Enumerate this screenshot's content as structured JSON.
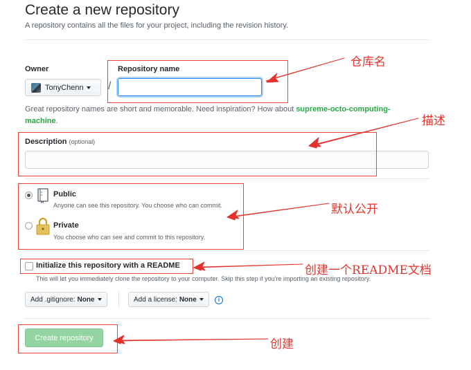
{
  "header": {
    "title": "Create a new repository",
    "subtitle": "A repository contains all the files for your project, including the revision history."
  },
  "owner": {
    "label": "Owner",
    "value": "TonyChenn"
  },
  "repo": {
    "label": "Repository name",
    "value": ""
  },
  "hint": {
    "prefix": "Great repository names are short and memorable. Need inspiration? How about ",
    "suggestion": "supreme-octo-computing-machine",
    "suffix": "."
  },
  "description": {
    "label": "Description",
    "optional": "(optional)",
    "value": ""
  },
  "visibility": {
    "public": {
      "title": "Public",
      "desc": "Anyone can see this repository. You choose who can commit.",
      "checked": true
    },
    "private": {
      "title": "Private",
      "desc": "You choose who can see and commit to this repository.",
      "checked": false
    }
  },
  "readme": {
    "label": "Initialize this repository with a README",
    "desc": "This will let you immediately clone the repository to your computer. Skip this step if you're importing an existing repository."
  },
  "gitignore": {
    "label": "Add .gitignore:",
    "value": "None"
  },
  "license": {
    "label": "Add a license:",
    "value": "None"
  },
  "create_button": "Create repository",
  "annotations": {
    "repo_name": "仓库名",
    "description": "描述",
    "visibility": "默认公开",
    "readme": "创建一个README文档",
    "create": "创建"
  },
  "colors": {
    "annotation": "#e3322b",
    "create_button": "#94d3a2",
    "suggestion": "#28a745",
    "focus": "#2188ff"
  }
}
